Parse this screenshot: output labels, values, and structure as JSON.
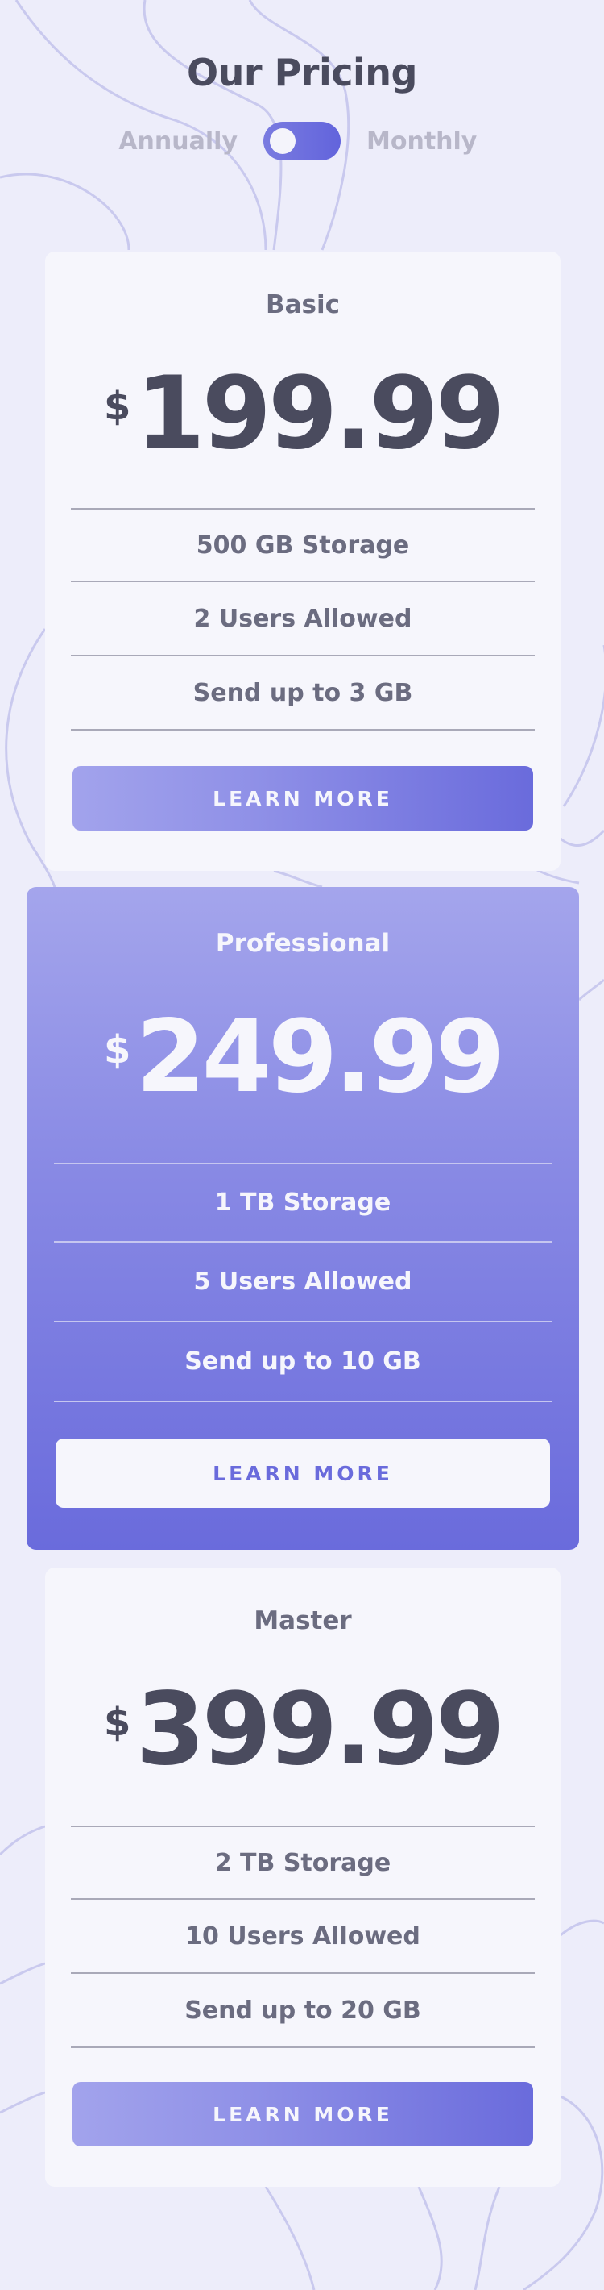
{
  "header": {
    "title": "Our Pricing"
  },
  "billing_toggle": {
    "left_label": "Annually",
    "right_label": "Monthly",
    "selected": "Annually"
  },
  "plans": [
    {
      "name": "Basic",
      "currency": "$",
      "price": "199.99",
      "features": [
        "500 GB Storage",
        "2 Users Allowed",
        "Send up to 3 GB"
      ],
      "button_label": "LEARN MORE"
    },
    {
      "name": "Professional",
      "currency": "$",
      "price": "249.99",
      "features": [
        "1 TB Storage",
        "5 Users Allowed",
        "Send up to 10 GB"
      ],
      "button_label": "LEARN MORE"
    },
    {
      "name": "Master",
      "currency": "$",
      "price": "399.99",
      "features": [
        "2 TB Storage",
        "10 Users Allowed",
        "Send up to 20 GB"
      ],
      "button_label": "LEARN MORE"
    }
  ],
  "colors": {
    "background": "#ededfa",
    "accent": "#6a6bdc",
    "card": "#f6f6fc",
    "text_dark": "#4a4b5e",
    "text_muted": "#6b6c80"
  }
}
